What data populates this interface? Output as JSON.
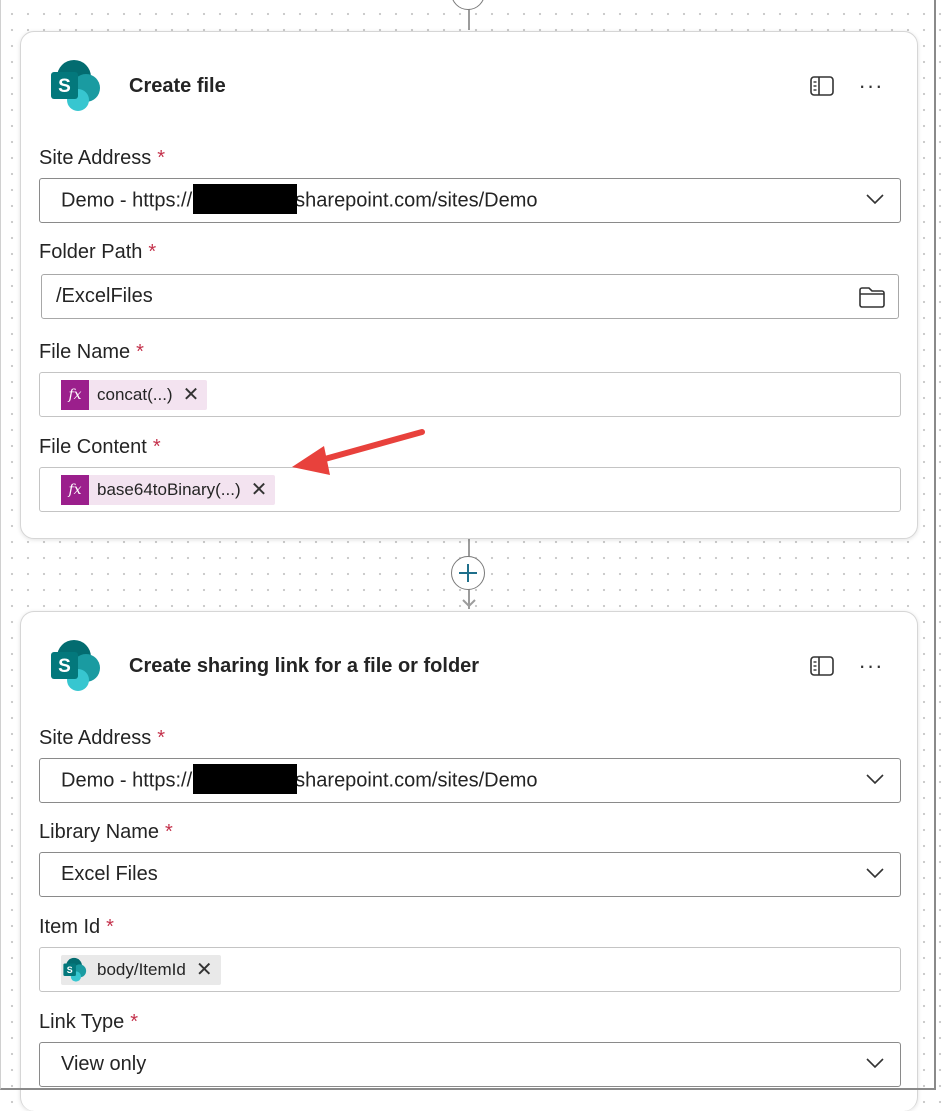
{
  "card1": {
    "title": "Create file",
    "site_address": {
      "label": "Site Address",
      "required": "*",
      "value_prefix": "Demo - https://",
      "value_suffix": "sharepoint.com/sites/Demo"
    },
    "folder_path": {
      "label": "Folder Path",
      "required": "*",
      "value": "/ExcelFiles"
    },
    "file_name": {
      "label": "File Name",
      "required": "*",
      "token": "concat(...)",
      "token_icon": "fx-icon"
    },
    "file_content": {
      "label": "File Content",
      "required": "*",
      "token": "base64toBinary(...)",
      "token_icon": "fx-icon"
    }
  },
  "card2": {
    "title": "Create sharing link for a file or folder",
    "site_address": {
      "label": "Site Address",
      "required": "*",
      "value_prefix": "Demo - https://",
      "value_suffix": "sharepoint.com/sites/Demo"
    },
    "library_name": {
      "label": "Library Name",
      "required": "*",
      "value": "Excel Files"
    },
    "item_id": {
      "label": "Item Id",
      "required": "*",
      "token": "body/ItemId",
      "token_icon": "sharepoint-icon"
    },
    "link_type": {
      "label": "Link Type",
      "required": "*",
      "value": "View only"
    }
  },
  "token_remove_glyph": "✕",
  "more_glyph": "···",
  "colors": {
    "fx_badge": "#9b1f8c",
    "fx_token_bg": "#f3e3f0",
    "required": "#c4314b",
    "annotation_arrow": "#e8413c",
    "sharepoint_dark": "#036c70",
    "sharepoint_mid": "#1a9ba1",
    "sharepoint_light": "#37c6d0"
  }
}
